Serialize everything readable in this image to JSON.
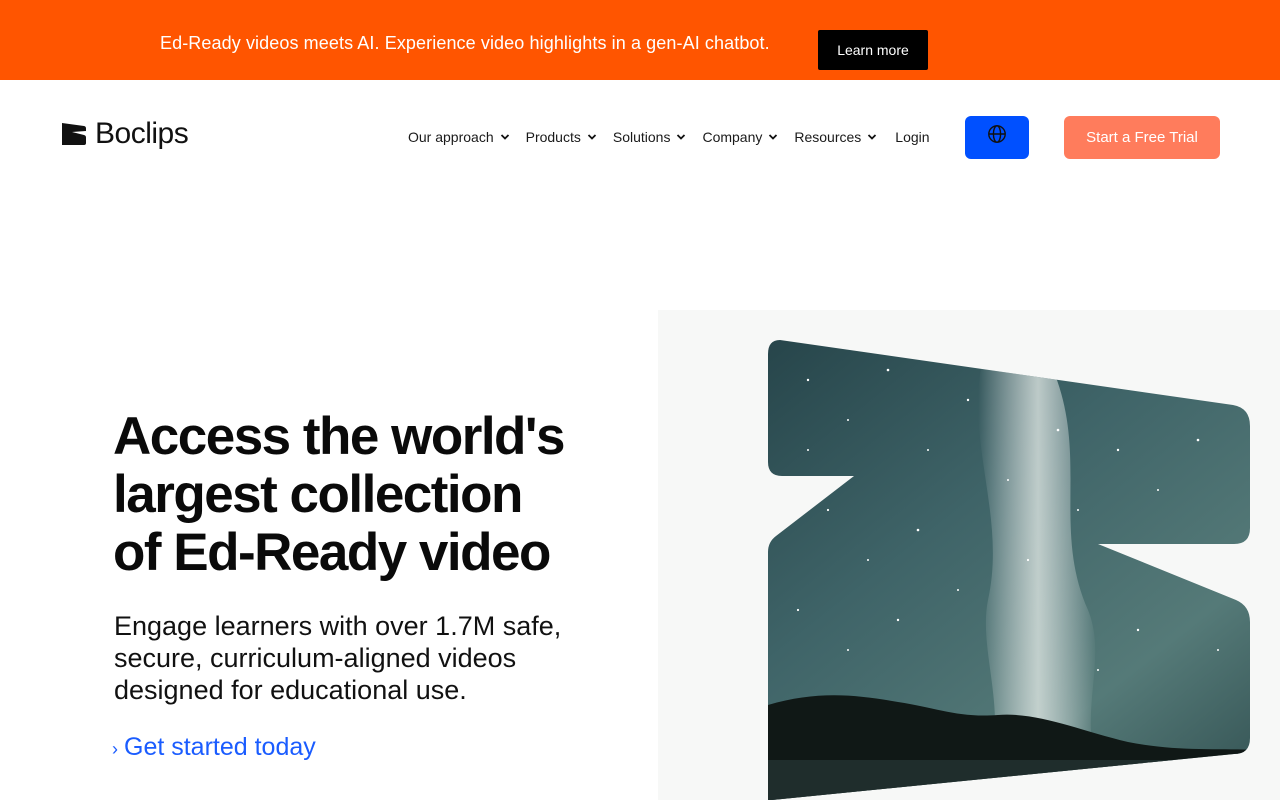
{
  "banner": {
    "text": "Ed-Ready videos meets AI. Experience video highlights in a gen-AI chatbot.",
    "button_label": "Learn more",
    "background": "#ff5500"
  },
  "header": {
    "logo_text": "Boclips",
    "nav": [
      {
        "label": "Our approach",
        "icon": "chevron-down-icon"
      },
      {
        "label": "Products",
        "icon": "chevron-down-icon"
      },
      {
        "label": "Solutions",
        "icon": "chevron-down-icon"
      },
      {
        "label": "Company",
        "icon": "chevron-down-icon"
      },
      {
        "label": "Resources",
        "icon": "chevron-down-icon"
      }
    ],
    "login_label": "Login",
    "language_icon": "globe-icon",
    "trial_label": "Start a Free Trial",
    "accent_blue": "#0050ff",
    "trial_color": "#ff7c5c"
  },
  "hero": {
    "title_lines": [
      "Access the world's",
      "largest collection",
      "of Ed-Ready video"
    ],
    "subtitle_lines": [
      "Engage learners with over 1.7M safe,",
      "secure, curriculum-aligned videos",
      "designed for educational use."
    ],
    "cta_label": "Get started today",
    "cta_color": "#1a5cff",
    "image": "milky-way-night-sky-in-logo-shape"
  }
}
